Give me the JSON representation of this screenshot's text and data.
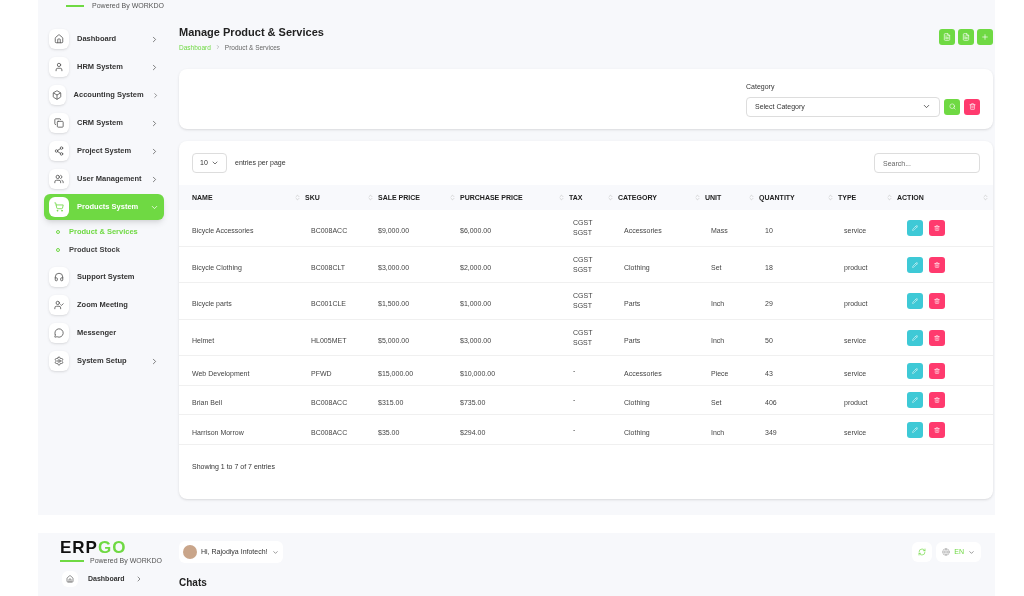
{
  "top_logo": {
    "tagline": "Powered By WORKDO"
  },
  "sidebar": {
    "items": [
      {
        "label": "Dashboard",
        "kind": "menu",
        "expanded": false,
        "selected": false
      },
      {
        "label": "HRM System",
        "kind": "menu",
        "expanded": false,
        "selected": false
      },
      {
        "label": "Accounting System",
        "kind": "menu",
        "expanded": false,
        "selected": false
      },
      {
        "label": "CRM System",
        "kind": "menu",
        "expanded": false,
        "selected": false
      },
      {
        "label": "Project System",
        "kind": "menu",
        "expanded": false,
        "selected": false
      },
      {
        "label": "User Management",
        "kind": "menu",
        "expanded": false,
        "selected": false
      },
      {
        "label": "Products System",
        "kind": "menu",
        "expanded": true,
        "selected": true,
        "children": [
          {
            "label": "Product & Services",
            "selected": true
          },
          {
            "label": "Product Stock",
            "selected": false
          }
        ]
      },
      {
        "label": "Support System",
        "kind": "link",
        "expanded": false,
        "selected": false
      },
      {
        "label": "Zoom Meeting",
        "kind": "link",
        "expanded": false,
        "selected": false
      },
      {
        "label": "Messenger",
        "kind": "link",
        "expanded": false,
        "selected": false
      },
      {
        "label": "System Setup",
        "kind": "menu",
        "expanded": false,
        "selected": false
      }
    ]
  },
  "page": {
    "title": "Manage Product & Services",
    "breadcrumb": [
      "Dashboard",
      "Product & Services"
    ]
  },
  "filter": {
    "label": "Category",
    "placeholder": "Select Category"
  },
  "table": {
    "page_size": "10",
    "page_size_label": "entries per page",
    "search_placeholder": "Search...",
    "columns": [
      "NAME",
      "SKU",
      "SALE PRICE",
      "PURCHASE PRICE",
      "TAX",
      "CATEGORY",
      "UNIT",
      "QUANTITY",
      "TYPE",
      "ACTION"
    ],
    "rows": [
      [
        "Bicycle Accessories",
        "BC008ACC",
        "$9,000.00",
        "$6,000.00",
        [
          "CGST",
          "SGST"
        ],
        "Accessories",
        "Mass",
        "10",
        "service"
      ],
      [
        "Bicycle Clothing",
        "BC008CLT",
        "$3,000.00",
        "$2,000.00",
        [
          "CGST",
          "SGST"
        ],
        "Clothing",
        "Set",
        "18",
        "product"
      ],
      [
        "Bicycle parts",
        "BC001CLE",
        "$1,500.00",
        "$1,000.00",
        [
          "CGST",
          "SGST"
        ],
        "Parts",
        "Inch",
        "29",
        "product"
      ],
      [
        "Helmet",
        "HL005MET",
        "$5,000.00",
        "$3,000.00",
        [
          "CGST",
          "SGST"
        ],
        "Parts",
        "Inch",
        "50",
        "service"
      ],
      [
        "Web Development",
        "PFWD",
        "$15,000.00",
        "$10,000.00",
        [
          "-"
        ],
        "Accessories",
        "Piece",
        "43",
        "service"
      ],
      [
        "Brian Bell",
        "BC008ACC",
        "$315.00",
        "$735.00",
        [
          "-"
        ],
        "Clothing",
        "Set",
        "406",
        "product"
      ],
      [
        "Harrison Morrow",
        "BC008ACC",
        "$35.00",
        "$294.00",
        [
          "-"
        ],
        "Clothing",
        "Inch",
        "349",
        "service"
      ]
    ],
    "footer": "Showing 1 to 7 of 7 entries"
  },
  "second_screen": {
    "logo": {
      "left": "ERP",
      "right": "GO",
      "tagline": "Powered By WORKDO"
    },
    "user": "Hi, Rajodiya Infotech!",
    "language": "EN",
    "sidebar_item": "Dashboard",
    "title": "Chats"
  }
}
